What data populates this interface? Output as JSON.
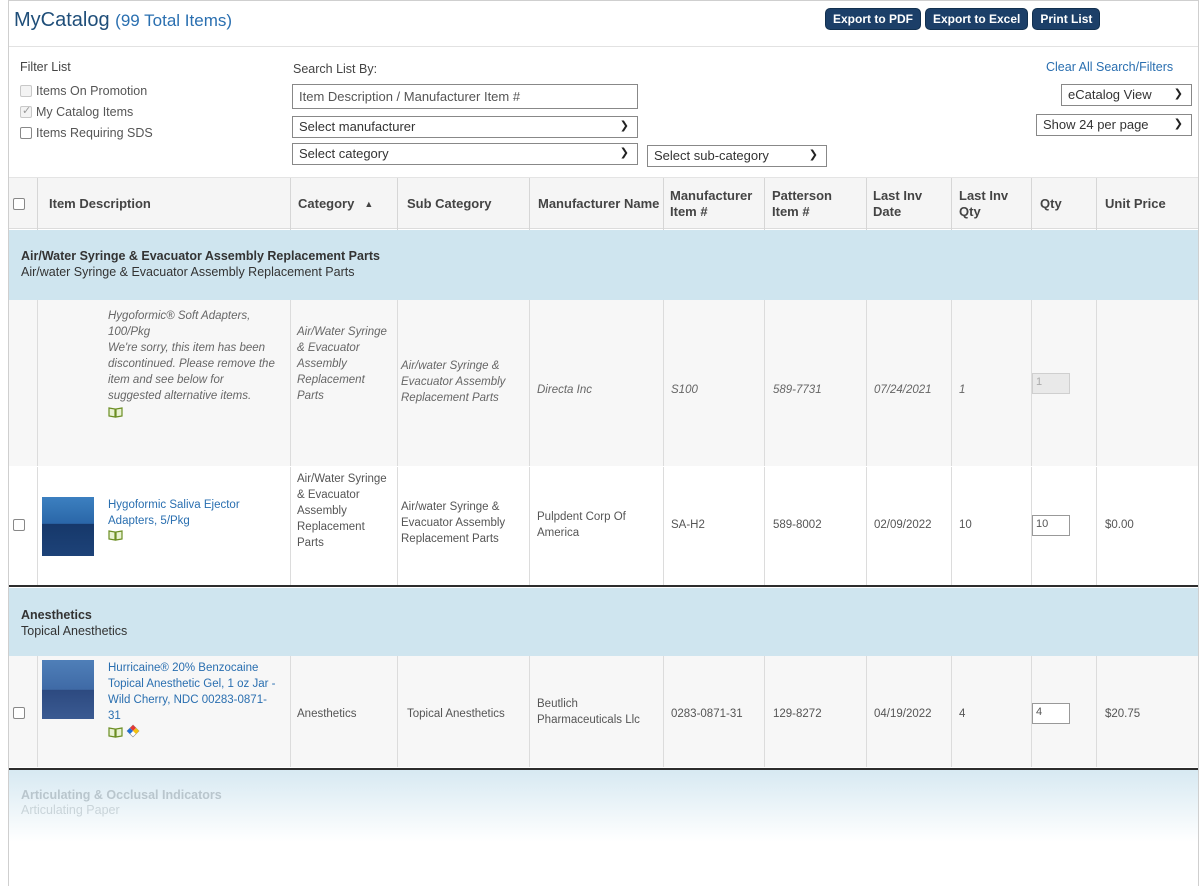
{
  "header": {
    "title": "MyCatalog",
    "count": "(99 Total Items)",
    "buttons": {
      "pdf": "Export to PDF",
      "excel": "Export to Excel",
      "print": "Print List"
    }
  },
  "filter": {
    "heading": "Filter List",
    "items": [
      {
        "label": "Items On Promotion",
        "checked": false,
        "disabled": true
      },
      {
        "label": "My Catalog Items",
        "checked": true,
        "disabled": true
      },
      {
        "label": "Items Requiring SDS",
        "checked": false,
        "disabled": false
      }
    ]
  },
  "search": {
    "heading": "Search List By:",
    "placeholder": "Item Description / Manufacturer Item #",
    "manufacturer": "Select manufacturer",
    "category": "Select category",
    "subcategory": "Select sub-category"
  },
  "options": {
    "clear": "Clear All Search/Filters",
    "view": "eCatalog View",
    "per_page": "Show 24 per page"
  },
  "columns": {
    "desc": "Item Description",
    "category": "Category",
    "sort_icon": "▲",
    "subcategory": "Sub Category",
    "mfr_name": "Manufacturer Name",
    "mfr_item": "Manufacturer Item #",
    "patterson_item": "Patterson Item #",
    "last_inv_date": "Last Inv Date",
    "last_inv_qty": "Last Inv Qty",
    "qty": "Qty",
    "unit_price": "Unit Price"
  },
  "groups": [
    {
      "title": "Air/Water Syringe & Evacuator Assembly Replacement Parts",
      "subtitle": "Air/water Syringe & Evacuator Assembly Replacement Parts"
    },
    {
      "title": "Anesthetics",
      "subtitle": "Topical Anesthetics"
    },
    {
      "title": "Articulating & Occlusal Indicators",
      "subtitle": "Articulating Paper"
    }
  ],
  "rows": [
    {
      "desc": "Hygoformic® Soft Adapters, 100/Pkg",
      "note": "We're sorry, this item has been discontinued. Please remove the item and see below for suggested alternative items.",
      "category": "Air/Water Syringe & Evacuator Assembly Replacement Parts",
      "subcategory": "Air/water Syringe & Evacuator Assembly Replacement Parts",
      "mfr_name": "Directa Inc",
      "mfr_item": "S100",
      "patterson_item": "589-7731",
      "last_inv_date": "07/24/2021",
      "last_inv_qty": "1",
      "qty": "1",
      "unit_price": "",
      "discontinued": true
    },
    {
      "desc": "Hygoformic Saliva Ejector Adapters, 5/Pkg",
      "category": "Air/Water Syringe & Evacuator Assembly Replacement Parts",
      "subcategory": "Air/water Syringe & Evacuator Assembly Replacement Parts",
      "mfr_name": "Pulpdent Corp Of America",
      "mfr_item": "SA-H2",
      "patterson_item": "589-8002",
      "last_inv_date": "02/09/2022",
      "last_inv_qty": "10",
      "qty": "10",
      "unit_price": "$0.00"
    },
    {
      "desc": "Hurricaine® 20% Benzocaine Topical Anesthetic Gel, 1 oz Jar - Wild Cherry, NDC 00283-0871-31",
      "category": "Anesthetics",
      "subcategory": "Topical Anesthetics",
      "mfr_name": "Beutlich Pharmaceuticals Llc",
      "mfr_item": "0283-0871-31",
      "patterson_item": "129-8272",
      "last_inv_date": "04/19/2022",
      "last_inv_qty": "4",
      "qty": "4",
      "unit_price": "$20.75"
    }
  ],
  "icons": {
    "book": "book-icon",
    "hazard": "hazard-diamond-icon",
    "chevron": "chevron-down-icon"
  }
}
